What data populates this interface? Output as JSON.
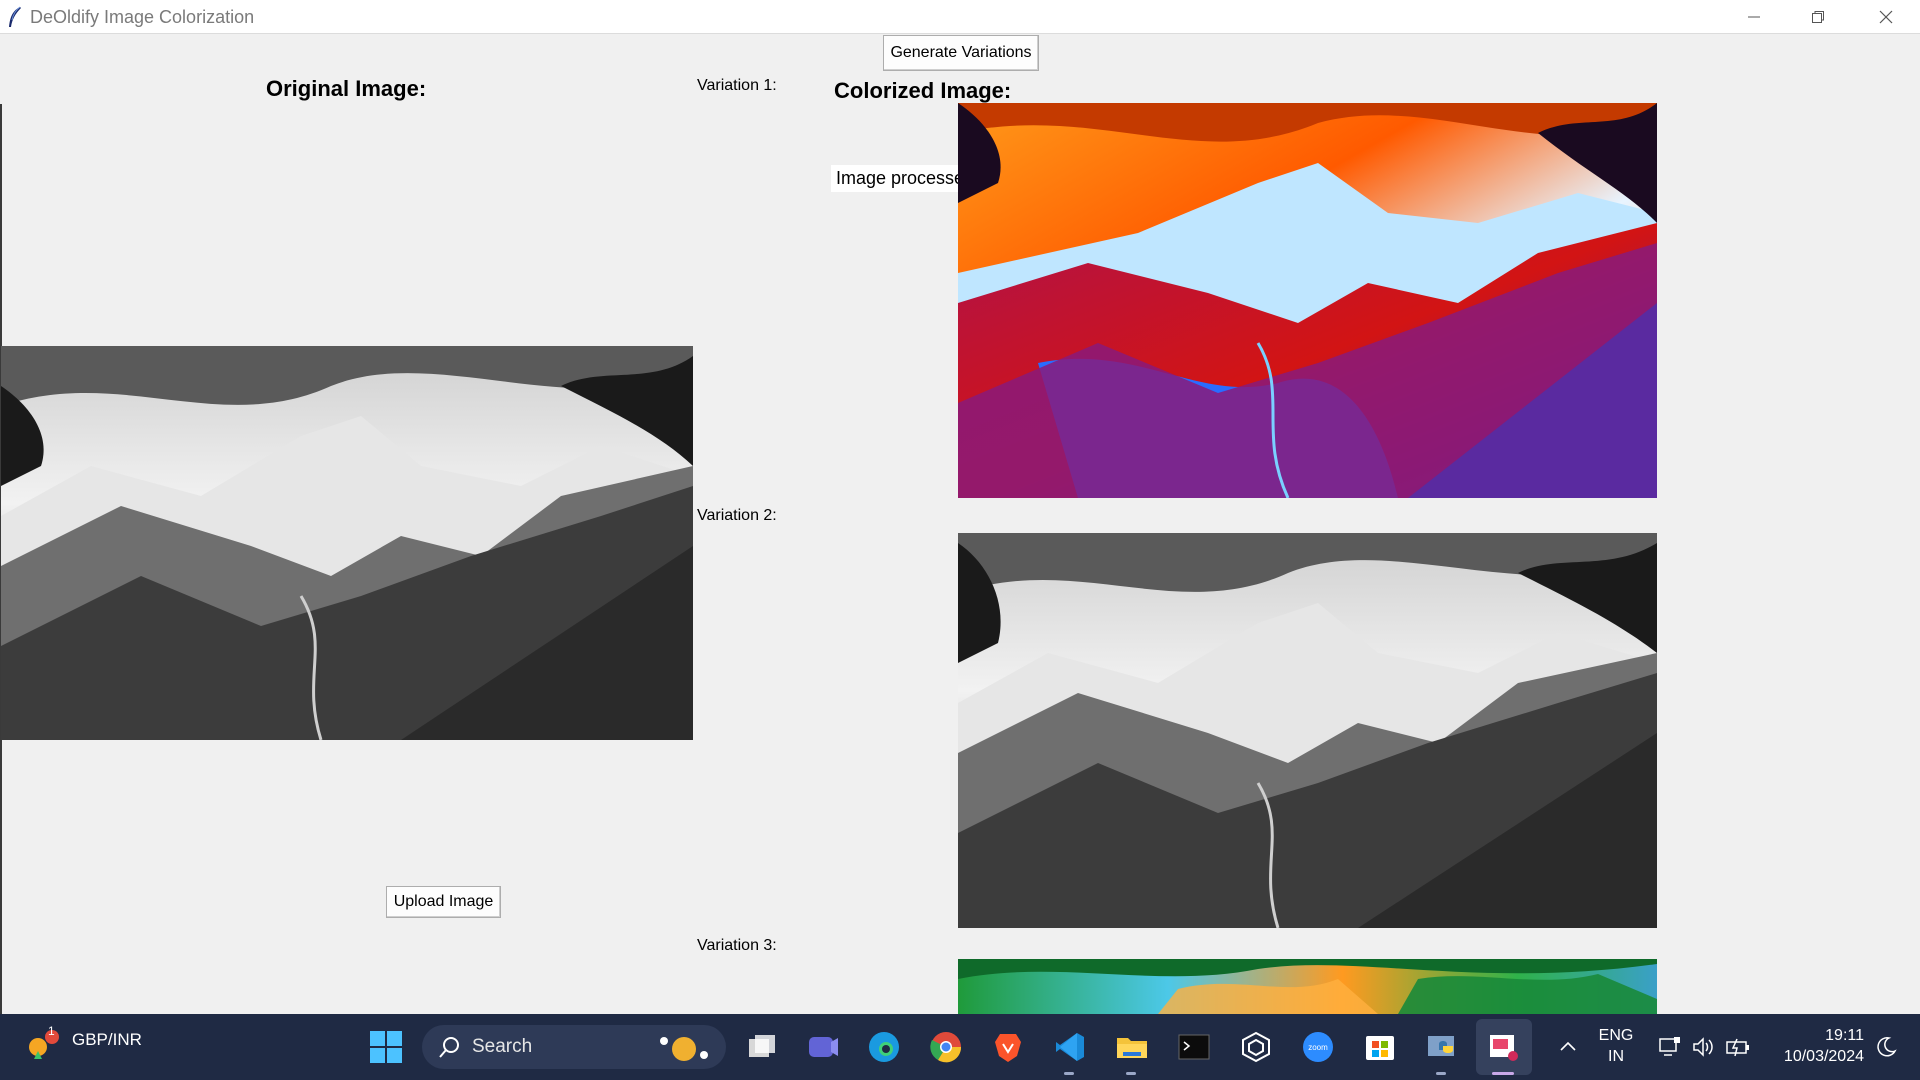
{
  "window": {
    "title": "DeOldify Image Colorization",
    "controls": [
      "minimize",
      "maximize",
      "close"
    ]
  },
  "main": {
    "generate_button": "Generate Variations",
    "original_heading": "Original Image:",
    "colorized_heading": "Colorized Image:",
    "variation_labels": [
      "Variation 1:",
      "Variation 2:",
      "Variation 3:"
    ],
    "status": "Image processed successfully.",
    "upload_button": "Upload Image",
    "images": {
      "original": "grayscale-mountain-landscape",
      "variation_1": "colorized-mountain-orange-red-blue",
      "variation_2": "grayscale-mountain-landscape",
      "variation_3": "colorized-mountain-green-teal"
    }
  },
  "taskbar": {
    "widget": {
      "label": "GBP/INR",
      "badge": "1",
      "icon": "weather-widget-icon"
    },
    "search_placeholder": "Search",
    "apps": [
      "start-icon",
      "search-icon",
      "task-view-icon",
      "teams-icon",
      "edge-icon",
      "chrome-icon",
      "brave-icon",
      "vscode-icon",
      "file-explorer-icon",
      "terminal-icon",
      "app-cube-icon",
      "zoom-icon",
      "store-icon",
      "python-icon",
      "snipping-tool-icon"
    ],
    "tray": {
      "language_line1": "ENG",
      "language_line2": "IN",
      "time": "19:11",
      "date": "10/03/2024"
    }
  },
  "colors": {
    "taskbar_bg": "#1f2a44",
    "window_bg": "#f0f0f0",
    "titlebar_bg": "#ffffff"
  }
}
